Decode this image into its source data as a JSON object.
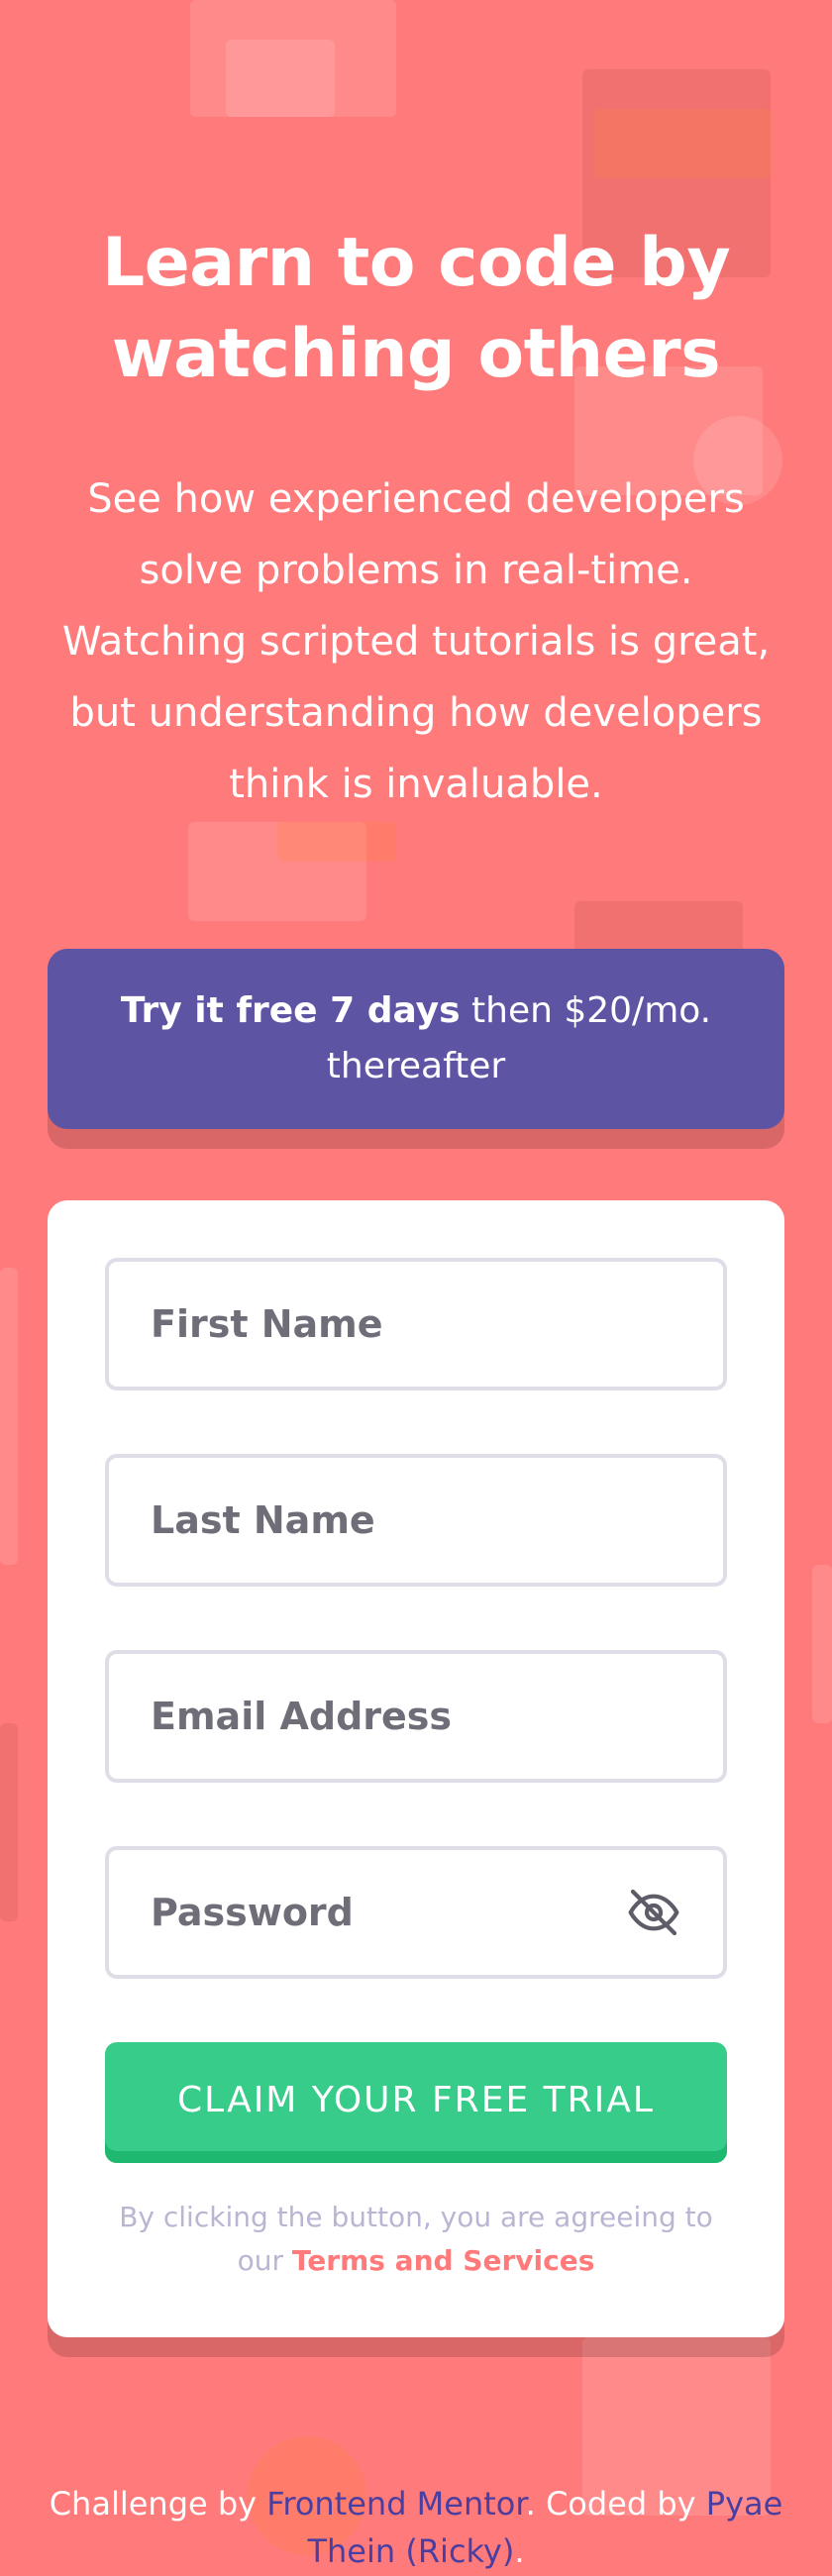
{
  "hero": {
    "title": "Learn to code by watching others",
    "description": "See how experienced developers solve problems in real-time. Watching scripted tutorials is great, but understanding how developers think is invaluable."
  },
  "promo": {
    "bold": "Try it free 7 days",
    "rest": " then $20/mo. thereafter"
  },
  "form": {
    "first_name": {
      "placeholder": "First Name",
      "value": ""
    },
    "last_name": {
      "placeholder": "Last Name",
      "value": ""
    },
    "email": {
      "placeholder": "Email Address",
      "value": ""
    },
    "password": {
      "placeholder": "Password",
      "value": "",
      "toggle_icon": "eye-off-icon"
    },
    "submit_label": "CLAIM YOUR FREE TRIAL",
    "terms_prefix": "By clicking the button, you are agreeing to our ",
    "terms_link": "Terms and Services"
  },
  "footer": {
    "prefix": "Challenge by ",
    "link1": "Frontend Mentor",
    "middle": ". Coded by ",
    "link2": "Pyae Thein (Ricky)",
    "suffix": "."
  },
  "colors": {
    "background": "#ff7a7a",
    "promo_bg": "#5e54a4",
    "accent_green": "#38cc8b",
    "terms_link": "#ff7a7a",
    "footer_link": "#4a3fa0"
  }
}
